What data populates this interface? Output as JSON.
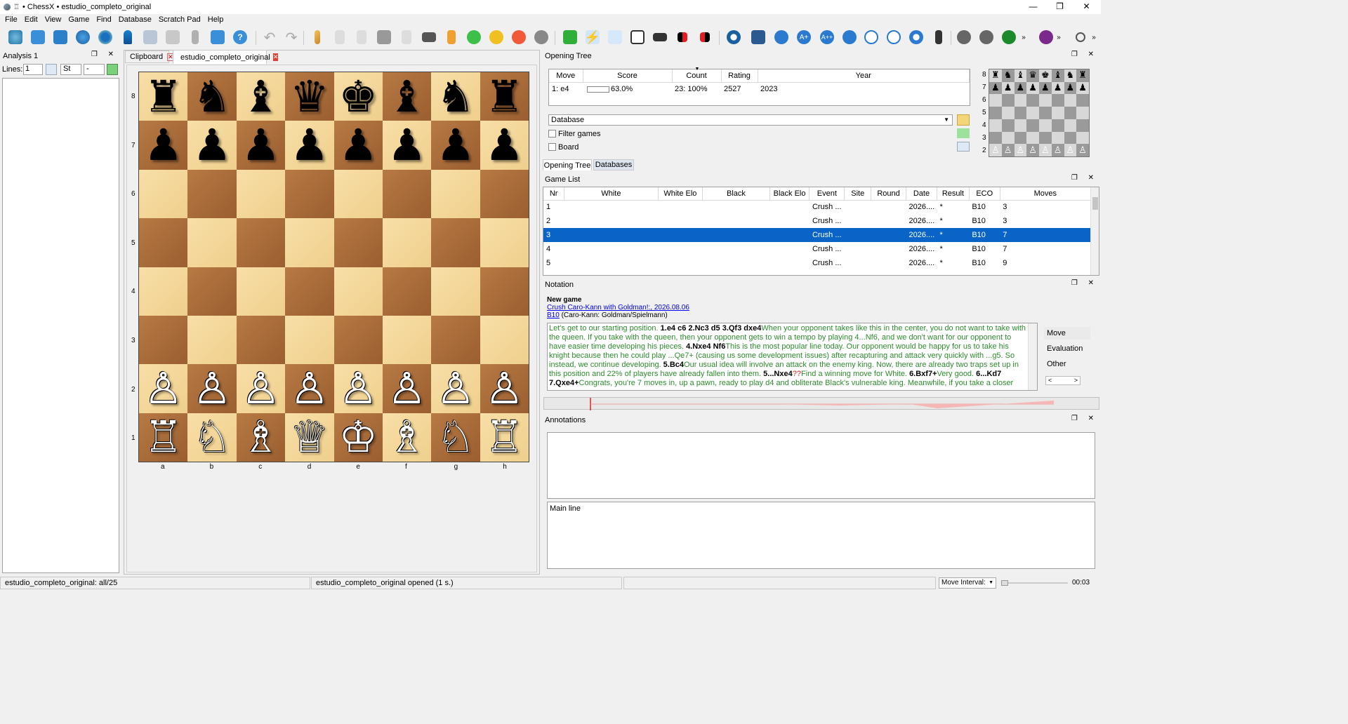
{
  "window": {
    "title": "• ChessX • estudio_completo_original",
    "glyph": "♖"
  },
  "menu": [
    "File",
    "Edit",
    "View",
    "Game",
    "Find",
    "Database",
    "Scratch Pad",
    "Help"
  ],
  "analysis": {
    "title": "Analysis 1",
    "lines_label": "Lines:",
    "lines_value": "1",
    "engine": "St",
    "mode": "-"
  },
  "tabs": {
    "clipboard": "Clipboard",
    "active": "estudio_completo_original"
  },
  "board": {
    "ranks": [
      "8",
      "7",
      "6",
      "5",
      "4",
      "3",
      "2",
      "1"
    ],
    "files": [
      "a",
      "b",
      "c",
      "d",
      "e",
      "f",
      "g",
      "h"
    ],
    "rows": [
      [
        "♜",
        "♞",
        "♝",
        "♛",
        "♚",
        "♝",
        "♞",
        "♜"
      ],
      [
        "♟",
        "♟",
        "♟",
        "♟",
        "♟",
        "♟",
        "♟",
        "♟"
      ],
      [
        "",
        "",
        "",
        "",
        "",
        "",
        "",
        ""
      ],
      [
        "",
        "",
        "",
        "",
        "",
        "",
        "",
        ""
      ],
      [
        "",
        "",
        "",
        "",
        "",
        "",
        "",
        ""
      ],
      [
        "",
        "",
        "",
        "",
        "",
        "",
        "",
        ""
      ],
      [
        "♙",
        "♙",
        "♙",
        "♙",
        "♙",
        "♙",
        "♙",
        "♙"
      ],
      [
        "♖",
        "♘",
        "♗",
        "♕",
        "♔",
        "♗",
        "♘",
        "♖"
      ]
    ]
  },
  "opening_tree": {
    "title": "Opening Tree",
    "columns": [
      "Move",
      "Score",
      "Count",
      "Rating",
      "Year"
    ],
    "row": {
      "move": "1: e4",
      "score": "63.0%",
      "score_fraction": 0.63,
      "count": "23: 100%",
      "rating": "2527",
      "year": "2023"
    },
    "database_select": "Database",
    "filter_label": "Filter games",
    "board_label": "Board",
    "tabs": [
      "Opening Tree",
      "Databases"
    ],
    "mini_ranks": [
      "8",
      "7",
      "6",
      "5",
      "4",
      "3",
      "2"
    ]
  },
  "game_list": {
    "title": "Game List",
    "columns": [
      "Nr",
      "White",
      "White Elo",
      "Black",
      "Black Elo",
      "Event",
      "Site",
      "Round",
      "Date",
      "Result",
      "ECO",
      "Moves"
    ],
    "rows": [
      {
        "nr": "1",
        "event": "Crush ...",
        "date": "2026....",
        "result": "*",
        "eco": "B10",
        "moves": "3"
      },
      {
        "nr": "2",
        "event": "Crush ...",
        "date": "2026....",
        "result": "*",
        "eco": "B10",
        "moves": "3"
      },
      {
        "nr": "3",
        "event": "Crush ...",
        "date": "2026....",
        "result": "*",
        "eco": "B10",
        "moves": "7"
      },
      {
        "nr": "4",
        "event": "Crush ...",
        "date": "2026....",
        "result": "*",
        "eco": "B10",
        "moves": "7"
      },
      {
        "nr": "5",
        "event": "Crush ...",
        "date": "2026....",
        "result": "*",
        "eco": "B10",
        "moves": "9"
      }
    ],
    "selected_index": 2
  },
  "notation": {
    "title": "Notation",
    "heading": "New game",
    "event_link": "Crush Caro-Kann with Goldman!:, 2026.08.06",
    "eco_link": "B10",
    "eco_desc": "(Caro-Kann: Goldman/Spielmann)",
    "segments": [
      {
        "t": "Let's get to our starting position. ",
        "b": false
      },
      {
        "t": "1.e4 c6 2.Nc3 d5 3.Qf3 dxe4",
        "b": true
      },
      {
        "t": "When your opponent takes like this in the center, you do not want to take with the queen. If you take with the queen, then your opponent gets to win a tempo by playing 4...Nf6, and we don't want for our opponent to have easier time developing his pieces. ",
        "b": false
      },
      {
        "t": "4.Nxe4 Nf6",
        "b": true
      },
      {
        "t": "This is the most popular line today. Our opponent would be happy for us to take his knight because then he could play ...Qe7+ (causing us some development issues) after recapturing and attack very quickly with ...g5. So instead, we continue developing. ",
        "b": false
      },
      {
        "t": "5.Bc4",
        "b": true
      },
      {
        "t": "Our usual idea will involve an attack on the enemy king. Now, there are already two traps set up in this position and 22% of players have already fallen into them. ",
        "b": false
      },
      {
        "t": "5...Nxe4",
        "b": true
      },
      {
        "t": "??",
        "b": false,
        "red": true
      },
      {
        "t": "Find a winning move for White. ",
        "b": false
      },
      {
        "t": "6.Bxf7+",
        "b": true
      },
      {
        "t": "Very good. ",
        "b": false
      },
      {
        "t": "6...Kd7 7.Qxe4+",
        "b": true
      },
      {
        "t": "Congrats, you're 7 moves in, up a pawn, ready to play d4 and obliterate Black's vulnerable king. Meanwhile, if you take a closer look, Black will struggle to",
        "b": false
      }
    ],
    "side_buttons": [
      "Move",
      "Evaluation",
      "Other"
    ]
  },
  "annotations": {
    "title": "Annotations",
    "main_line": "Main line"
  },
  "status": {
    "left": "estudio_completo_original: all/25",
    "middle": "estudio_completo_original opened (1 s.)",
    "move_interval": "Move Interval:",
    "time": "00:03"
  },
  "colors": {
    "selection": "#0a64c8",
    "link": "#0000ee",
    "comment": "#2e8b2e",
    "annotation_red": "#e02020"
  }
}
